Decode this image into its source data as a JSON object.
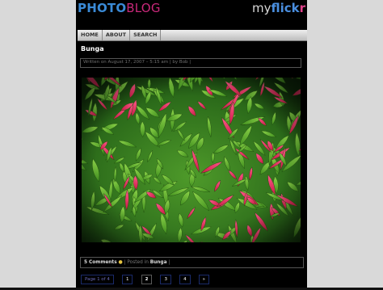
{
  "header": {
    "logo_photo": "PHOTO",
    "logo_blog": "BLOG",
    "myflickr_my": "my",
    "myflickr_flick": "flick",
    "myflickr_r": "r"
  },
  "nav": {
    "items": [
      {
        "label": "HOME"
      },
      {
        "label": "ABOUT"
      },
      {
        "label": "SEARCH"
      }
    ]
  },
  "post": {
    "title": "Bunga",
    "meta": "Written on August 17, 2007 – 5:15 am | by Bob |",
    "photo_alt": "Bunga"
  },
  "footer": {
    "comments": "5 Comments",
    "posted_in": "Posted in",
    "category": "Bunga"
  },
  "pagination": {
    "label": "Page 1 of 4",
    "pages": [
      "1",
      "2",
      "3",
      "4"
    ],
    "next": "»",
    "current": "2"
  },
  "colors": {
    "logo_photo": "#3a8ad6",
    "logo_blog": "#c9287a",
    "flickr_blue": "#4a8fe0",
    "flickr_pink": "#e0418a",
    "background": "#000000"
  }
}
